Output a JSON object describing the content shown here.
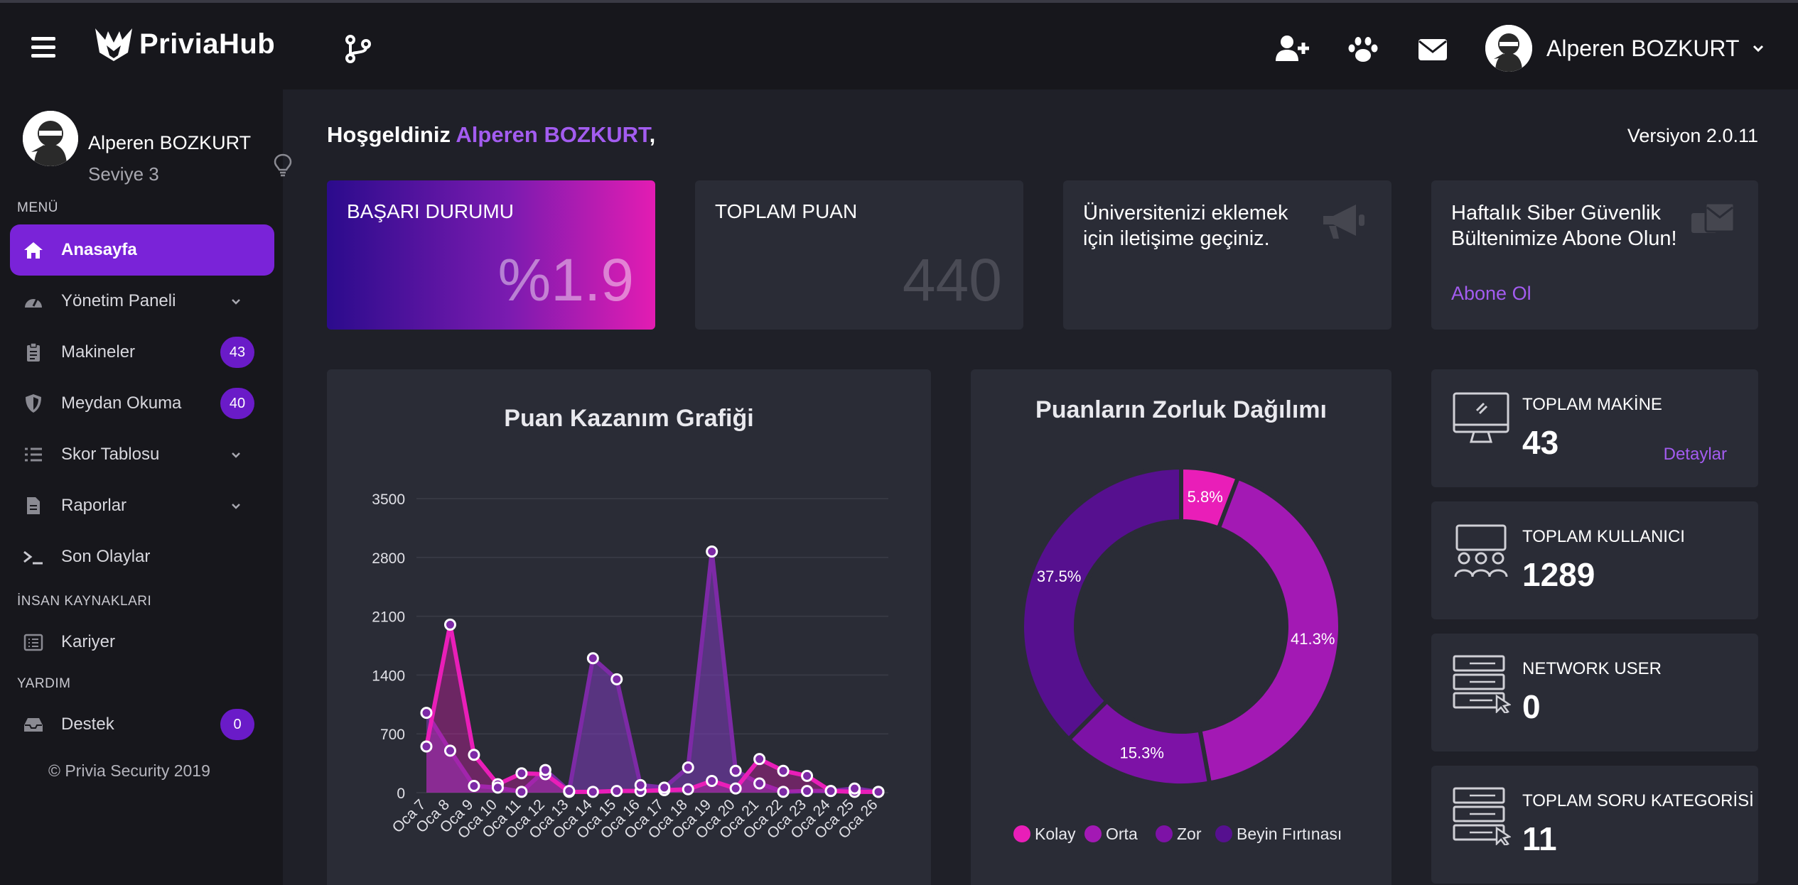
{
  "topbar": {
    "logo_text": "PriviaHub",
    "user_name": "Alperen BOZKURT",
    "icons": [
      "menu-icon",
      "branch-icon",
      "add-user-icon",
      "paw-icon",
      "envelope-icon",
      "chevron-down-icon"
    ]
  },
  "sidebar": {
    "profile": {
      "name": "Alperen BOZKURT",
      "level": "Seviye 3"
    },
    "sections": {
      "menu": "MENÜ",
      "hr": "İNSAN KAYNAKLARI",
      "help": "YARDIM"
    },
    "items": [
      {
        "label": "Anasayfa",
        "icon": "home-icon",
        "active": true
      },
      {
        "label": "Yönetim Paneli",
        "icon": "dashboard-icon",
        "caret": true
      },
      {
        "label": "Makineler",
        "icon": "clipboard-icon",
        "badge": "43"
      },
      {
        "label": "Meydan Okuma",
        "icon": "shield-icon",
        "badge": "40"
      },
      {
        "label": "Skor Tablosu",
        "icon": "list-icon",
        "caret": true
      },
      {
        "label": "Raporlar",
        "icon": "file-icon",
        "caret": true
      },
      {
        "label": "Son Olaylar",
        "icon": "terminal-icon"
      },
      {
        "label": "Kariyer",
        "icon": "list-alt-icon"
      },
      {
        "label": "Destek",
        "icon": "inbox-icon",
        "badge": "0"
      }
    ],
    "copyright": "© Privia Security 2019"
  },
  "main": {
    "welcome_prefix": "Hoşgeldiniz",
    "welcome_name": "Alperen BOZKURT",
    "welcome_suffix": ",",
    "version": "Versiyon 2.0.11",
    "cards": {
      "success_title": "BAŞARI DURUMU",
      "success_value": "%1.9",
      "total_title": "TOPLAM PUAN",
      "total_value": "440",
      "uni_text": "Üniversitenizi eklemek için iletişime geçiniz.",
      "bulletin_text": "Haftalık Siber Güvenlik Bültenimize Abone Olun!",
      "bulletin_link": "Abone Ol"
    },
    "stats": [
      {
        "label": "TOPLAM MAKİNE",
        "value": "43",
        "link": "Detaylar",
        "icon": "monitor-icon"
      },
      {
        "label": "TOPLAM KULLANICI",
        "value": "1289",
        "icon": "users-icon"
      },
      {
        "label": "NETWORK USER",
        "value": "0",
        "icon": "network-icon"
      },
      {
        "label": "TOPLAM SORU KATEGORİSİ",
        "value": "11",
        "icon": "category-icon"
      }
    ]
  },
  "colors": {
    "accent": "#7a23d8",
    "link": "#a35cf0",
    "kolay": "#e91eb8",
    "orta": "#a319b4",
    "zor": "#7d12a6",
    "beyin": "#56108f"
  },
  "chart_data": [
    {
      "type": "area",
      "title": "Puan Kazanım Grafiği",
      "categories": [
        "Oca 7",
        "Oca 8",
        "Oca 9",
        "Oca 10",
        "Oca 11",
        "Oca 12",
        "Oca 13",
        "Oca 14",
        "Oca 15",
        "Oca 16",
        "Oca 17",
        "Oca 18",
        "Oca 19",
        "Oca 20",
        "Oca 21",
        "Oca 22",
        "Oca 23",
        "Oca 24",
        "Oca 25",
        "Oca 26"
      ],
      "ylim": [
        0,
        3500
      ],
      "yticks": [
        0,
        700,
        1400,
        2100,
        2800,
        3500
      ],
      "grid": true,
      "series": [
        {
          "values": [
            550,
            2000,
            450,
            100,
            230,
            220,
            10,
            10,
            20,
            20,
            30,
            40,
            140,
            50,
            400,
            260,
            200,
            20,
            10,
            10
          ]
        },
        {
          "values": [
            950,
            500,
            80,
            60,
            10,
            270,
            20,
            1600,
            1350,
            90,
            60,
            300,
            2870,
            260,
            110,
            10,
            20,
            20,
            50,
            10
          ]
        }
      ]
    },
    {
      "type": "pie",
      "title": "Puanların Zorluk Dağılımı",
      "donut": true,
      "legend": "bottom",
      "slices": [
        {
          "name": "Kolay",
          "value": 5.8,
          "label": "5.8%"
        },
        {
          "name": "Orta",
          "value": 41.3,
          "label": "41.3%"
        },
        {
          "name": "Zor",
          "value": 15.3,
          "label": "15.3%"
        },
        {
          "name": "Beyin Fırtınası",
          "value": 37.5,
          "label": "37.5%"
        }
      ]
    }
  ]
}
